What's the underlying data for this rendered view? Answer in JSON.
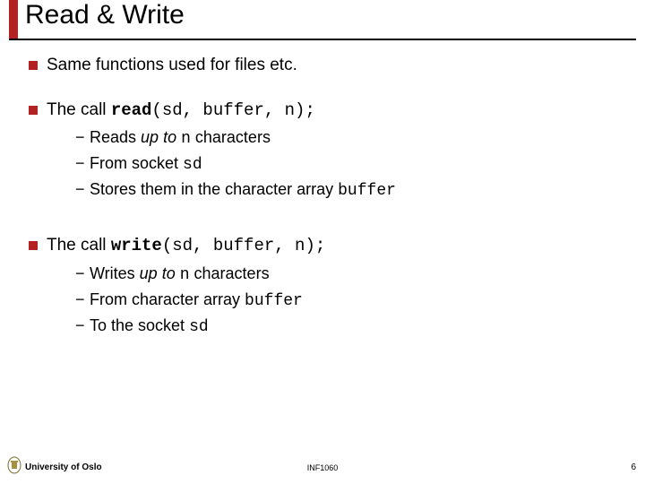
{
  "title": "Read & Write",
  "bullets": {
    "b1": "Same functions used for files etc.",
    "b2_pre": "The call ",
    "b2_bold": "read",
    "b2_rest": "(sd, buffer, n);",
    "b2_sub1_a": "Reads ",
    "b2_sub1_ital": "up to ",
    "b2_sub1_mono": "n",
    "b2_sub1_b": " characters",
    "b2_sub2_a": "From socket ",
    "b2_sub2_mono": "sd",
    "b2_sub3_a": "Stores them in the character array ",
    "b2_sub3_mono": "buffer",
    "b3_pre": "The call ",
    "b3_bold": "write",
    "b3_rest": "(sd, buffer, n);",
    "b3_sub1_a": "Writes ",
    "b3_sub1_ital": "up to ",
    "b3_sub1_mono": "n",
    "b3_sub1_b": " characters",
    "b3_sub2_a": "From character array ",
    "b3_sub2_mono": "buffer",
    "b3_sub3_a": "To the socket ",
    "b3_sub3_mono": "sd"
  },
  "footer": {
    "university": "University of Oslo",
    "course": "INF1060",
    "page": "6"
  }
}
